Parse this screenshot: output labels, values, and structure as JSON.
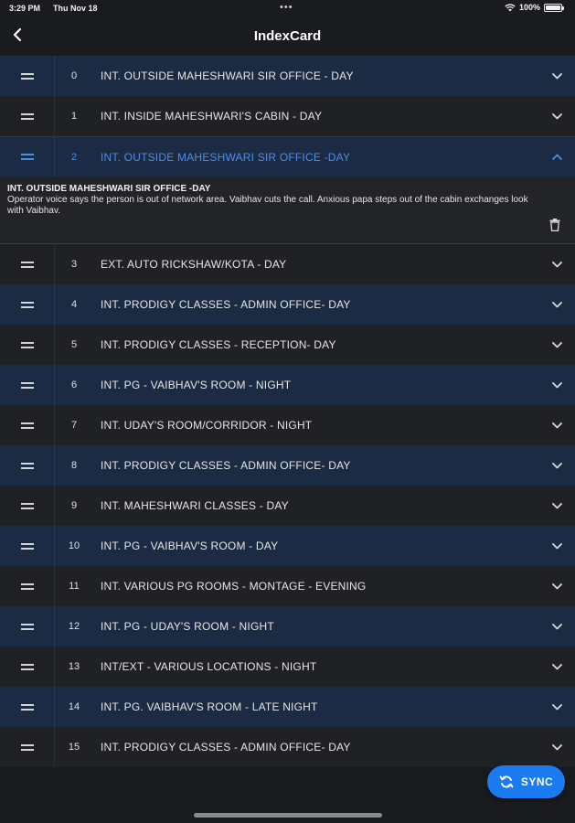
{
  "status": {
    "time": "3:29 PM",
    "date": "Thu Nov 18",
    "dots": "•••",
    "battery": "100%"
  },
  "nav": {
    "title": "IndexCard"
  },
  "rows": [
    {
      "num": "0",
      "title": "INT. OUTSIDE MAHESHWARI SIR OFFICE  - DAY"
    },
    {
      "num": "1",
      "title": "INT. INSIDE MAHESHWARI'S CABIN - DAY"
    },
    {
      "num": "2",
      "title": "INT. OUTSIDE MAHESHWARI SIR OFFICE  -DAY"
    },
    {
      "num": "3",
      "title": "EXT. AUTO RICKSHAW/KOTA - DAY"
    },
    {
      "num": "4",
      "title": "INT. PRODIGY CLASSES - ADMIN OFFICE- DAY"
    },
    {
      "num": "5",
      "title": "INT. PRODIGY CLASSES - RECEPTION- DAY"
    },
    {
      "num": "6",
      "title": "INT. PG - VAIBHAV'S ROOM - NIGHT"
    },
    {
      "num": "7",
      "title": "INT. UDAY'S ROOM/CORRIDOR - NIGHT"
    },
    {
      "num": "8",
      "title": "INT. PRODIGY CLASSES - ADMIN OFFICE- DAY"
    },
    {
      "num": "9",
      "title": "INT. MAHESHWARI CLASSES - DAY"
    },
    {
      "num": "10",
      "title": "INT. PG - VAIBHAV'S ROOM - DAY"
    },
    {
      "num": "11",
      "title": "INT. VARIOUS PG ROOMS - MONTAGE - EVENING"
    },
    {
      "num": "12",
      "title": "INT. PG - UDAY'S ROOM - NIGHT"
    },
    {
      "num": "13",
      "title": "INT/EXT - VARIOUS LOCATIONS - NIGHT"
    },
    {
      "num": "14",
      "title": "INT. PG. VAIBHAV'S ROOM - LATE NIGHT"
    },
    {
      "num": "15",
      "title": "INT. PRODIGY CLASSES - ADMIN OFFICE- DAY"
    }
  ],
  "expanded": {
    "heading": "INT. OUTSIDE MAHESHWARI SIR OFFICE  -DAY",
    "body": "Operator voice says the person is out of network area. Vaibhav cuts the call. Anxious papa steps out of the cabin exchanges look with Vaibhav."
  },
  "sync": {
    "label": "SYNC"
  },
  "colors": {
    "accent": "#1a7cf0",
    "selected_text": "#4a8fe8",
    "row_navy": "#1c2b44",
    "row_dark": "#202124",
    "background": "#1a1b1e"
  }
}
